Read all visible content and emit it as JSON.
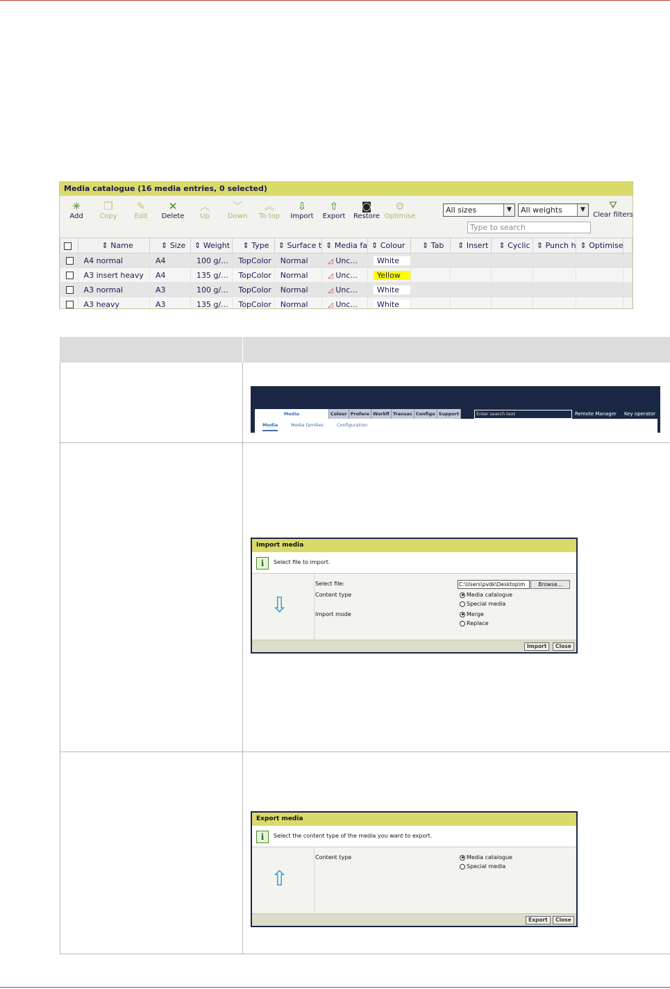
{
  "catalogue": {
    "title": "Media catalogue (16 media entries, 0 selected)",
    "toolbar": [
      {
        "label": "Add",
        "icon": "add-icon",
        "enabled": true
      },
      {
        "label": "Copy",
        "icon": "copy-icon",
        "enabled": false
      },
      {
        "label": "Edit",
        "icon": "edit-icon",
        "enabled": false
      },
      {
        "label": "Delete",
        "icon": "delete-icon",
        "enabled": true
      },
      {
        "label": "Up",
        "icon": "up-icon",
        "enabled": false
      },
      {
        "label": "Down",
        "icon": "down-icon",
        "enabled": false
      },
      {
        "label": "To top",
        "icon": "to-top-icon",
        "enabled": false
      },
      {
        "label": "Import",
        "icon": "import-icon",
        "enabled": true
      },
      {
        "label": "Export",
        "icon": "export-icon",
        "enabled": true
      },
      {
        "label": "Restore",
        "icon": "restore-icon",
        "enabled": true
      },
      {
        "label": "Optimise",
        "icon": "optimise-icon",
        "enabled": false
      }
    ],
    "filter_size": "All sizes",
    "filter_weight": "All weights",
    "search_placeholder": "Type to search",
    "clear_filters": "Clear filters",
    "columns": [
      "Name",
      "Size",
      "Weight",
      "Type",
      "Surface t",
      "Media fa",
      "Colour",
      "Tab",
      "Insert",
      "Cyclic",
      "Punch h",
      "Optimise"
    ],
    "rows": [
      {
        "name": "A4 normal",
        "size": "A4",
        "weight": "100 g/...",
        "type": "TopColor",
        "surface": "Normal",
        "family": "Unc...",
        "colour": "White"
      },
      {
        "name": "A3 insert heavy",
        "size": "A4",
        "weight": "135 g/...",
        "type": "TopColor",
        "surface": "Normal",
        "family": "Unc...",
        "colour": "Yellow"
      },
      {
        "name": "A3 normal",
        "size": "A3",
        "weight": "100 g/...",
        "type": "TopColor",
        "surface": "Normal",
        "family": "Unc...",
        "colour": "White"
      },
      {
        "name": "A3 heavy",
        "size": "A3",
        "weight": "135 g/...",
        "type": "TopColor",
        "surface": "Normal",
        "family": "Unc...",
        "colour": "White"
      }
    ],
    "colors": {
      "title_bar": "#dada6a",
      "highlight_yellow": "#ffff00"
    }
  },
  "navbar": {
    "tabs": [
      "Media",
      "Colour",
      "Prefere",
      "Workfl",
      "Transac",
      "Configu",
      "Support"
    ],
    "search_placeholder": "Enter search text",
    "remote_manager": "Remote Manager",
    "key_operator": "Key operator",
    "subtabs": [
      "Media",
      "Media families",
      "Configuration"
    ]
  },
  "import_dialog": {
    "title": "Import media",
    "info": "Select file to import.",
    "select_file_label": "Select file:",
    "file_path": "C:\\Users\\pvdk\\Desktop\\m",
    "browse": "Browse...",
    "content_type_label": "Content type",
    "content_options": [
      "Media catalogue",
      "Special media"
    ],
    "import_mode_label": "Import mode",
    "mode_options": [
      "Merge",
      "Replace"
    ],
    "btn_import": "Import",
    "btn_close": "Close"
  },
  "export_dialog": {
    "title": "Export media",
    "info": "Select the content type of the media you want to export.",
    "content_type_label": "Content type",
    "content_options": [
      "Media catalogue",
      "Special media"
    ],
    "btn_export": "Export",
    "btn_close": "Close"
  }
}
